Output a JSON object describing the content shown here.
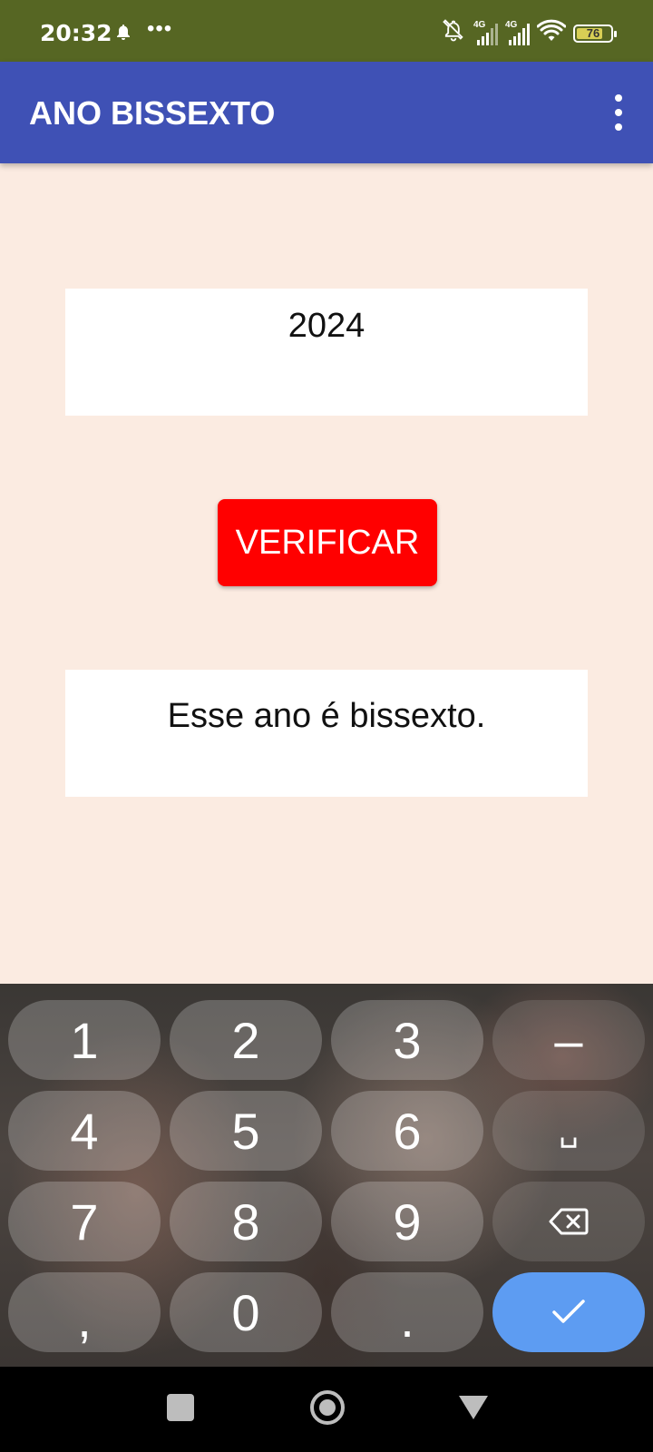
{
  "status_bar": {
    "time": "20:32",
    "dots": "•••",
    "sim1_label": "4G",
    "sim2_label": "4G",
    "battery": "76"
  },
  "app_bar": {
    "title": "ANO BISSEXTO",
    "color": "#3f51b5"
  },
  "form": {
    "year_value": "2024",
    "verify_label": "VERIFICAR",
    "verify_color": "#ff0000",
    "result_text": "Esse ano é bissexto."
  },
  "keyboard": {
    "keys": [
      [
        "1",
        "2",
        "3",
        "–"
      ],
      [
        "4",
        "5",
        "6",
        "␣"
      ],
      [
        "7",
        "8",
        "9",
        "backspace-icon"
      ],
      [
        ",",
        "0",
        ".",
        "check-icon"
      ]
    ],
    "enter_color": "#5d9cf2"
  },
  "nav_bar": {
    "buttons": [
      "recents-icon",
      "home-icon",
      "back-icon"
    ]
  }
}
